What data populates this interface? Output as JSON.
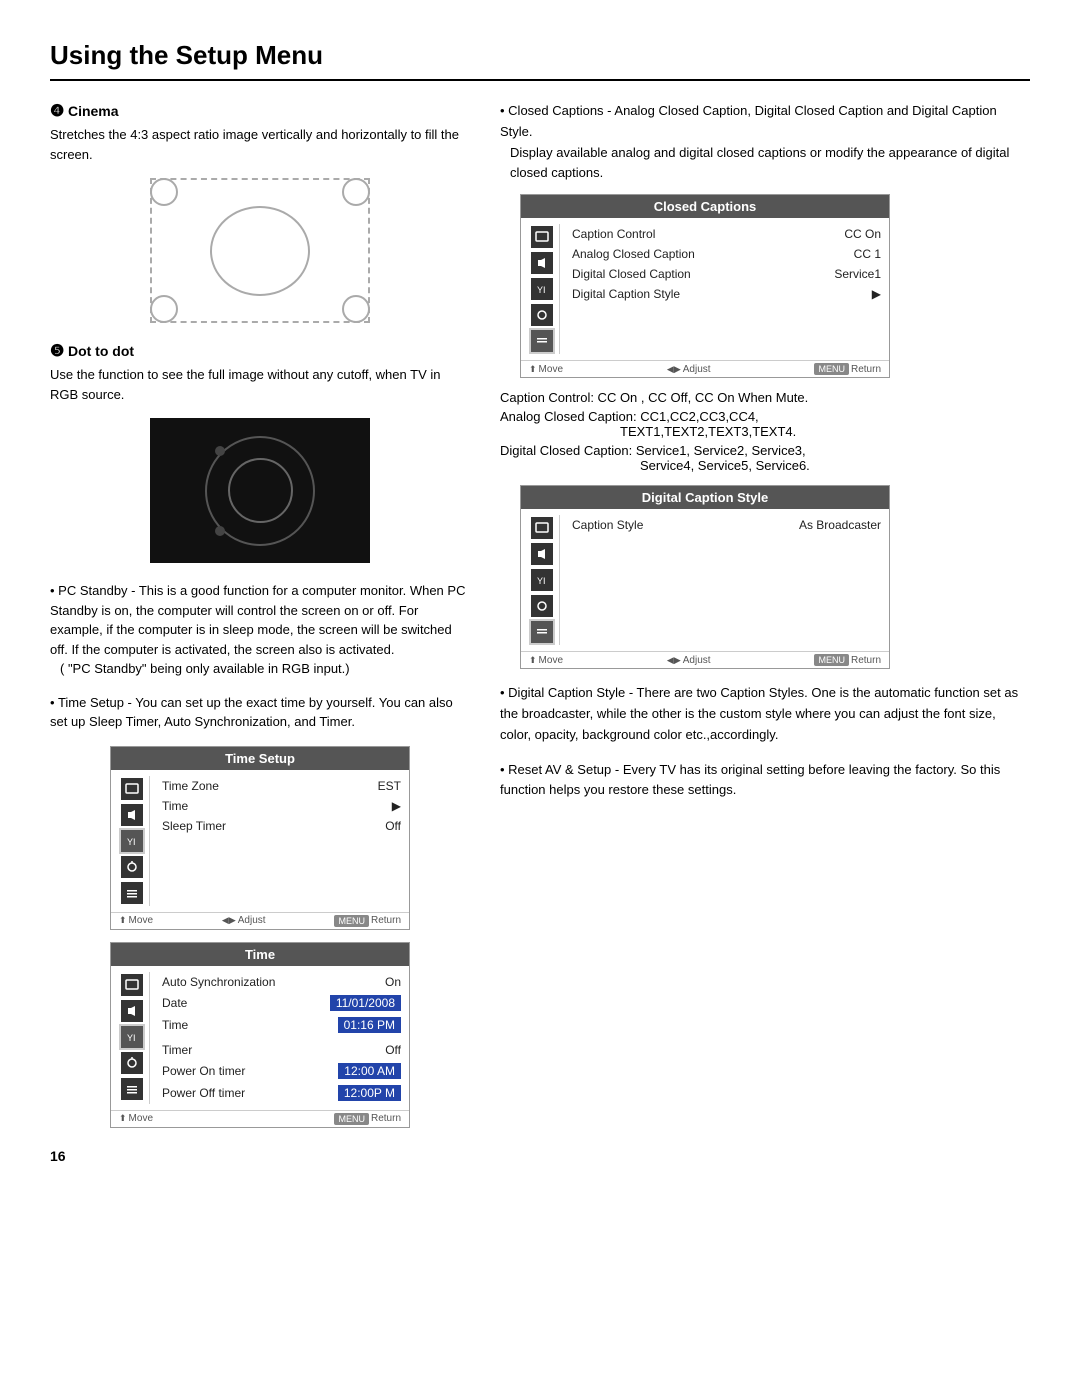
{
  "page": {
    "title": "Using the Setup Menu",
    "page_number": "16"
  },
  "left": {
    "cinema_number": "4",
    "cinema_title": "Cinema",
    "cinema_body": "Stretches the 4:3 aspect ratio image vertically and horizontally to fill the screen.",
    "dot_number": "5",
    "dot_title": "Dot to dot",
    "dot_body": "Use the function to see the full image without any cutoff, when TV in RGB source.",
    "pc_standby_bullet": "PC Standby - This is a good function for a computer monitor. When PC Standby is on, the computer will control the screen on or off. For example, if the computer is in sleep mode, the screen will be switched off. If the computer is activated, the screen also is activated.",
    "pc_standby_note": "( \"PC Standby\" being only available in RGB input.)",
    "time_setup_bullet": "Time Setup - You can set up the exact time by yourself. You can also set up Sleep Timer, Auto Synchronization, and Timer.",
    "time_setup_panel": {
      "title": "Time Setup",
      "rows": [
        {
          "label": "Time Zone",
          "value": "EST",
          "type": "normal"
        },
        {
          "label": "Time",
          "value": "",
          "arrow": "▶",
          "type": "normal"
        },
        {
          "label": "Sleep Timer",
          "value": "Off",
          "type": "normal"
        }
      ],
      "footer": {
        "move": "Move",
        "adjust": "Adjust",
        "menu_label": "MENU",
        "return": "Return"
      }
    },
    "time_panel": {
      "title": "Time",
      "rows": [
        {
          "label": "Auto Synchronization",
          "value": "On",
          "type": "normal"
        },
        {
          "label": "Date",
          "value": "11/01/2008",
          "type": "box"
        },
        {
          "label": "Time",
          "value": "01:16 PM",
          "type": "box"
        },
        {
          "label": "",
          "value": "",
          "type": "spacer"
        },
        {
          "label": "Timer",
          "value": "Off",
          "type": "normal"
        },
        {
          "label": "Power On timer",
          "value": "12:00 AM",
          "type": "box"
        },
        {
          "label": "Power Off timer",
          "value": "12:00P M",
          "type": "box"
        }
      ],
      "footer": {
        "move": "Move",
        "menu_label": "MENU",
        "return": "Return"
      }
    }
  },
  "right": {
    "closed_captions_intro": "Closed Captions - Analog Closed Caption, Digital Closed Caption and Digital Caption Style.",
    "closed_captions_desc": "Display available analog and digital closed captions or modify the appearance of digital closed captions.",
    "closed_captions_panel": {
      "title": "Closed Captions",
      "rows": [
        {
          "label": "Caption Control",
          "value": "CC On",
          "type": "normal"
        },
        {
          "label": "Analog Closed Caption",
          "value": "CC 1",
          "type": "normal"
        },
        {
          "label": "Digital Closed Caption",
          "value": "Service1",
          "type": "normal"
        },
        {
          "label": "Digital Caption Style",
          "value": "",
          "arrow": "▶",
          "type": "normal"
        }
      ],
      "footer": {
        "move": "Move",
        "adjust": "Adjust",
        "menu_label": "MENU",
        "return": "Return"
      }
    },
    "caption_control_info": "Caption Control:  CC On , CC Off, CC On When Mute.",
    "analog_caption_info": "Analog Closed Caption: CC1,CC2,CC3,CC4,",
    "analog_caption_info2": "TEXT1,TEXT2,TEXT3,TEXT4.",
    "digital_caption_info": "Digital Closed Caption: Service1, Service2, Service3,",
    "digital_caption_info2": "Service4, Service5, Service6.",
    "digital_caption_style_panel": {
      "title": "Digital Caption Style",
      "rows": [
        {
          "label": "Caption Style",
          "value": "As Broadcaster",
          "type": "normal"
        }
      ],
      "footer": {
        "move": "Move",
        "adjust": "Adjust",
        "menu_label": "MENU",
        "return": "Return"
      }
    },
    "digital_style_bullet": "Digital Caption Style - There are two Caption Styles. One is  the automatic function set as the broadcaster, while the other is the custom style where you can adjust the font size, color, opacity, background color etc.,accordingly.",
    "reset_bullet": "Reset AV & Setup - Every TV has its original setting before leaving the factory. So this function helps you restore these settings."
  }
}
